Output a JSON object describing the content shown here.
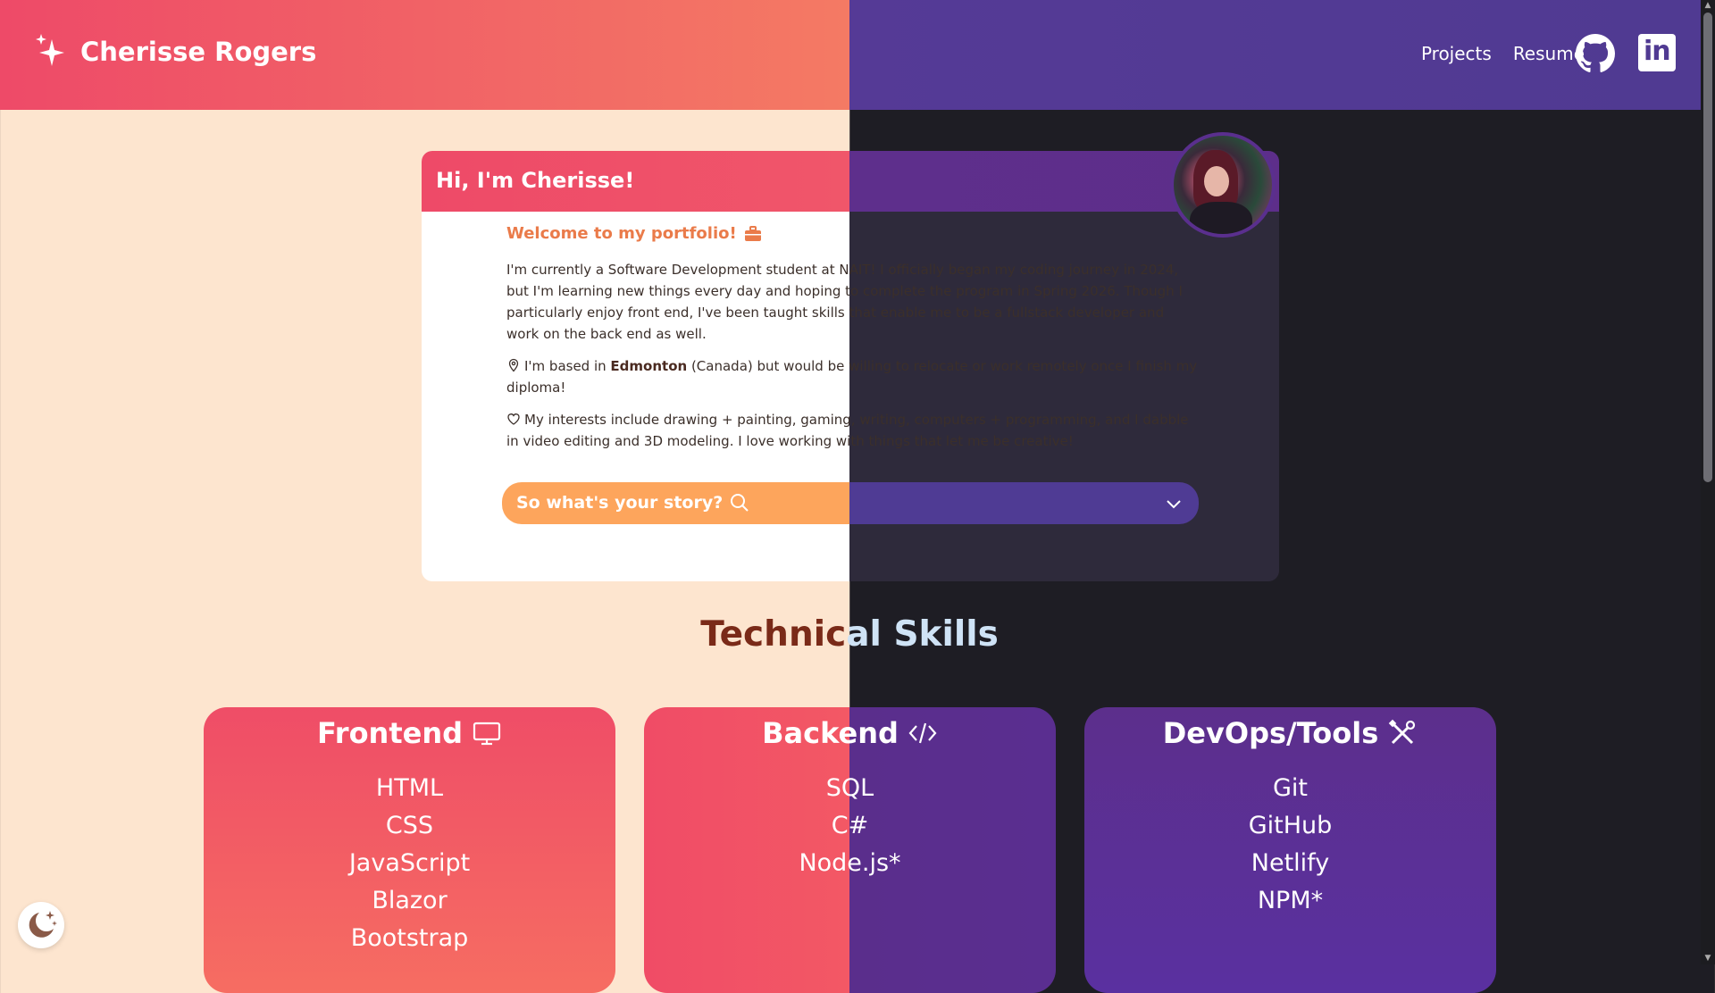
{
  "header": {
    "brand": "Cherisse Rogers",
    "nav": [
      {
        "label": "Projects"
      },
      {
        "label": "Resume"
      }
    ],
    "social": [
      "github-icon",
      "linkedin-icon"
    ],
    "linkedin_glyph": "in"
  },
  "intro": {
    "title": "Hi, I'm Cherisse!",
    "welcome": "Welcome to my portfolio!",
    "para1": "I'm currently a Software Development student at NAIT! I officially began my coding journey in 2024, but I'm learning new things every day and hoping to complete the program in Spring 2026. Though I particularly enjoy front end, I've been taught skills that enable me to be a fullstack developer and work on the back end as well.",
    "para2_prefix": "I'm based in ",
    "para2_city": "Edmonton",
    "para2_suffix": " (Canada) but would be willing to relocate or work remotely once I finish my diploma!",
    "para3": "My interests include drawing + painting, gaming, writing, computers + programming, and I dabble in video editing and 3D modeling. I love working with things that let me be creative!",
    "story_label": "So what's your story?"
  },
  "skills": {
    "title_left": "Technic",
    "title_right": "al Skills",
    "frontend": {
      "title": "Frontend",
      "items": [
        "HTML",
        "CSS",
        "JavaScript",
        "Blazor",
        "Bootstrap"
      ]
    },
    "backend": {
      "title": "Backend",
      "items": [
        "SQL",
        "C#",
        "Node.js*"
      ]
    },
    "devops": {
      "title": "DevOps/Tools",
      "items": [
        "Git",
        "GitHub",
        "Netlify",
        "NPM*"
      ]
    }
  },
  "colors": {
    "coral": "#ee4a68",
    "purple": "#503a92",
    "orange": "#fda55c",
    "cream": "#fde5cf",
    "dark": "#1e1d24"
  }
}
